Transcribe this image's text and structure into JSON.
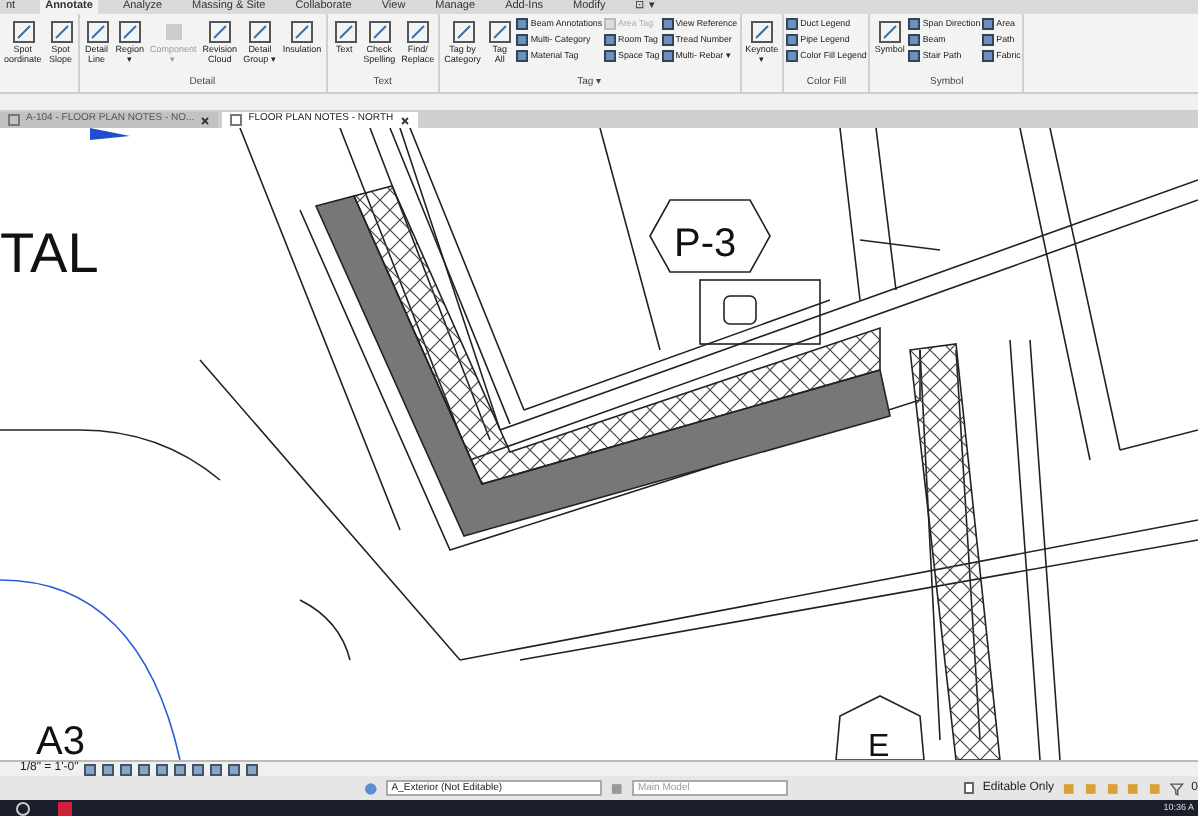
{
  "ribbon_tabs": [
    {
      "label": "nt",
      "selected": false
    },
    {
      "label": "Annotate",
      "selected": true
    },
    {
      "label": "Analyze",
      "selected": false
    },
    {
      "label": "Massing & Site",
      "selected": false
    },
    {
      "label": "Collaborate",
      "selected": false
    },
    {
      "label": "View",
      "selected": false
    },
    {
      "label": "Manage",
      "selected": false
    },
    {
      "label": "Add-Ins",
      "selected": false
    },
    {
      "label": "Modify",
      "selected": false
    },
    {
      "label": "⊡ ▾",
      "selected": false
    }
  ],
  "ribbon_panels": [
    {
      "items": [
        {
          "kind": "large",
          "lines": [
            "Spot",
            "oordinate"
          ]
        },
        {
          "kind": "large",
          "lines": [
            "Spot",
            "Slope"
          ]
        }
      ]
    },
    {
      "label": "Detail",
      "items": [
        {
          "kind": "large",
          "lines": [
            "Detail",
            "Line"
          ]
        },
        {
          "kind": "large",
          "lines": [
            "Region",
            "▾"
          ]
        },
        {
          "kind": "large",
          "lines": [
            "Component",
            "▾"
          ],
          "disabled": true
        },
        {
          "kind": "large",
          "lines": [
            "Revision",
            "Cloud"
          ]
        },
        {
          "kind": "large",
          "lines": [
            "Detail",
            "Group ▾"
          ]
        },
        {
          "kind": "large",
          "lines": [
            "Insulation"
          ]
        }
      ]
    },
    {
      "label": "Text",
      "items": [
        {
          "kind": "large",
          "lines": [
            "Text"
          ]
        },
        {
          "kind": "large",
          "lines": [
            "Check",
            "Spelling"
          ]
        },
        {
          "kind": "large",
          "lines": [
            "Find/",
            "Replace"
          ]
        }
      ]
    },
    {
      "label": "Tag ▾",
      "items": [
        {
          "kind": "large",
          "lines": [
            "Tag by",
            "Category"
          ]
        },
        {
          "kind": "large",
          "lines": [
            "Tag",
            "All"
          ]
        },
        {
          "kind": "stack",
          "items": [
            {
              "label": "Beam Annotations",
              "disabled": false
            },
            {
              "label": "Multi- Category",
              "disabled": false
            },
            {
              "label": "Material Tag",
              "disabled": false
            }
          ]
        },
        {
          "kind": "stack",
          "items": [
            {
              "label": "Area Tag",
              "disabled": true
            },
            {
              "label": "Room Tag",
              "disabled": false
            },
            {
              "label": "Space Tag",
              "disabled": false
            }
          ]
        },
        {
          "kind": "stack",
          "items": [
            {
              "label": "View Reference",
              "disabled": false
            },
            {
              "label": "Tread Number",
              "disabled": false
            },
            {
              "label": "Multi- Rebar ▾",
              "disabled": false
            }
          ]
        }
      ]
    },
    {
      "items": [
        {
          "kind": "large",
          "lines": [
            "Keynote",
            "▾"
          ]
        }
      ]
    },
    {
      "label": "Color Fill",
      "items": [
        {
          "kind": "stack",
          "items": [
            {
              "label": "Duct Legend",
              "disabled": false
            },
            {
              "label": "Pipe Legend",
              "disabled": false
            },
            {
              "label": "Color Fill Legend",
              "disabled": false
            }
          ]
        }
      ]
    },
    {
      "label": "Symbol",
      "items": [
        {
          "kind": "large",
          "lines": [
            "Symbol"
          ]
        },
        {
          "kind": "stack",
          "items": [
            {
              "label": "Span Direction",
              "disabled": false
            },
            {
              "label": "Beam",
              "disabled": false
            },
            {
              "label": "Stair Path",
              "disabled": false
            }
          ]
        },
        {
          "kind": "stack",
          "items": [
            {
              "label": "Area",
              "disabled": false
            },
            {
              "label": "Path",
              "disabled": false
            },
            {
              "label": "Fabric",
              "disabled": false
            }
          ]
        }
      ]
    }
  ],
  "doc_tabs": [
    {
      "label": "A-104 - FLOOR PLAN NOTES - NO...",
      "selected": false
    },
    {
      "label": "FLOOR PLAN NOTES - NORTH",
      "selected": true
    }
  ],
  "drawing": {
    "texts": [
      "TAL",
      "P-3",
      "A3",
      "E"
    ]
  },
  "view_control_bar": {
    "scale": "1/8\" = 1'-0\""
  },
  "status_bar": {
    "workset": "A_Exterior (Not Editable)",
    "design_option": "Main Model",
    "editable_only": {
      "label": "Editable Only",
      "checked": false
    },
    "filter_count": "0"
  },
  "taskbar": {
    "clock": "10:36 A"
  }
}
